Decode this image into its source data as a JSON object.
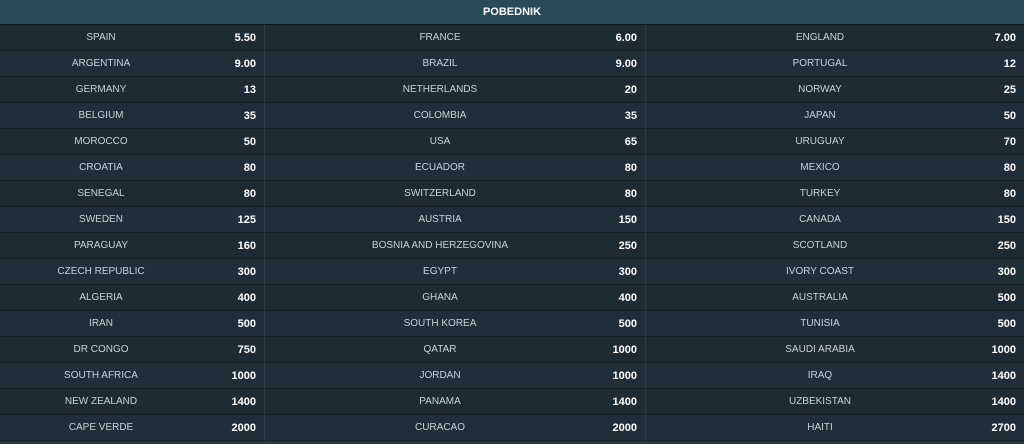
{
  "header": {
    "title": "POBEDNIK"
  },
  "rows": [
    [
      {
        "team": "SPAIN",
        "odd": "5.50"
      },
      {
        "team": "FRANCE",
        "odd": "6.00"
      },
      {
        "team": "ENGLAND",
        "odd": "7.00"
      }
    ],
    [
      {
        "team": "ARGENTINA",
        "odd": "9.00"
      },
      {
        "team": "BRAZIL",
        "odd": "9.00"
      },
      {
        "team": "PORTUGAL",
        "odd": "12"
      }
    ],
    [
      {
        "team": "GERMANY",
        "odd": "13"
      },
      {
        "team": "NETHERLANDS",
        "odd": "20"
      },
      {
        "team": "NORWAY",
        "odd": "25"
      }
    ],
    [
      {
        "team": "BELGIUM",
        "odd": "35"
      },
      {
        "team": "COLOMBIA",
        "odd": "35"
      },
      {
        "team": "JAPAN",
        "odd": "50"
      }
    ],
    [
      {
        "team": "MOROCCO",
        "odd": "50"
      },
      {
        "team": "USA",
        "odd": "65"
      },
      {
        "team": "URUGUAY",
        "odd": "70"
      }
    ],
    [
      {
        "team": "CROATIA",
        "odd": "80"
      },
      {
        "team": "ECUADOR",
        "odd": "80"
      },
      {
        "team": "MEXICO",
        "odd": "80"
      }
    ],
    [
      {
        "team": "SENEGAL",
        "odd": "80"
      },
      {
        "team": "SWITZERLAND",
        "odd": "80"
      },
      {
        "team": "TURKEY",
        "odd": "80"
      }
    ],
    [
      {
        "team": "SWEDEN",
        "odd": "125"
      },
      {
        "team": "AUSTRIA",
        "odd": "150"
      },
      {
        "team": "CANADA",
        "odd": "150"
      }
    ],
    [
      {
        "team": "PARAGUAY",
        "odd": "160"
      },
      {
        "team": "BOSNIA AND HERZEGOVINA",
        "odd": "250"
      },
      {
        "team": "SCOTLAND",
        "odd": "250"
      }
    ],
    [
      {
        "team": "CZECH REPUBLIC",
        "odd": "300"
      },
      {
        "team": "EGYPT",
        "odd": "300"
      },
      {
        "team": "IVORY COAST",
        "odd": "300"
      }
    ],
    [
      {
        "team": "ALGERIA",
        "odd": "400"
      },
      {
        "team": "GHANA",
        "odd": "400"
      },
      {
        "team": "AUSTRALIA",
        "odd": "500"
      }
    ],
    [
      {
        "team": "IRAN",
        "odd": "500"
      },
      {
        "team": "SOUTH KOREA",
        "odd": "500"
      },
      {
        "team": "TUNISIA",
        "odd": "500"
      }
    ],
    [
      {
        "team": "DR CONGO",
        "odd": "750"
      },
      {
        "team": "QATAR",
        "odd": "1000"
      },
      {
        "team": "SAUDI ARABIA",
        "odd": "1000"
      }
    ],
    [
      {
        "team": "SOUTH AFRICA",
        "odd": "1000"
      },
      {
        "team": "JORDAN",
        "odd": "1000"
      },
      {
        "team": "IRAQ",
        "odd": "1400"
      }
    ],
    [
      {
        "team": "NEW ZEALAND",
        "odd": "1400"
      },
      {
        "team": "PANAMA",
        "odd": "1400"
      },
      {
        "team": "UZBEKISTAN",
        "odd": "1400"
      }
    ],
    [
      {
        "team": "CAPE VERDE",
        "odd": "2000"
      },
      {
        "team": "CURACAO",
        "odd": "2000"
      },
      {
        "team": "HAITI",
        "odd": "2700"
      }
    ]
  ]
}
